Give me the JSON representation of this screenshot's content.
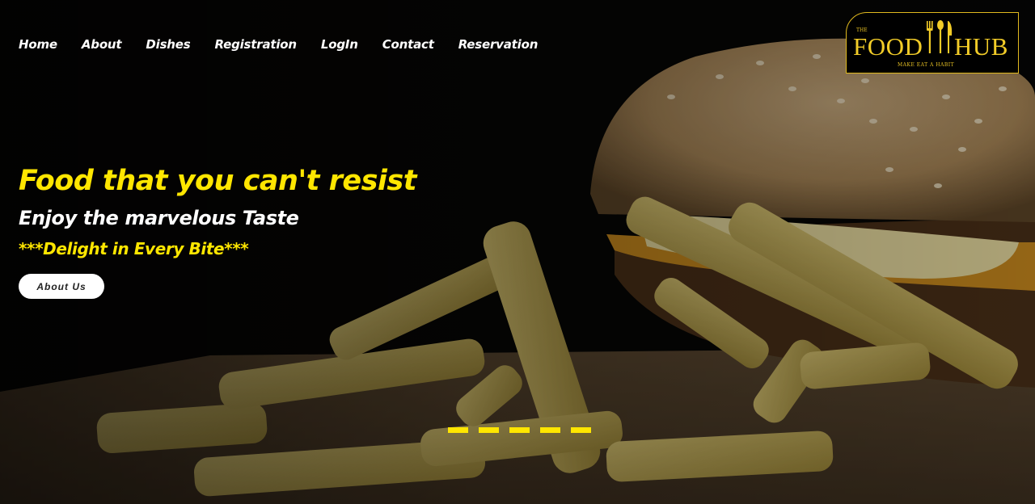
{
  "nav": {
    "items": [
      {
        "label": "Home"
      },
      {
        "label": "About"
      },
      {
        "label": "Dishes"
      },
      {
        "label": "Registration"
      },
      {
        "label": "LogIn"
      },
      {
        "label": "Contact"
      },
      {
        "label": "Reservation"
      }
    ]
  },
  "logo": {
    "prefix": "THE",
    "word1": "FOOD",
    "word2": "HUB",
    "tagline": "MAKE EAT A HABIT",
    "icon": "fork-spoon-knife-icon",
    "color": "#f2cc28"
  },
  "hero": {
    "headline": "Food that you can't resist",
    "subheadline": "Enjoy the marvelous Taste",
    "tagline": "***Delight in Every Bite***",
    "button_label": "About Us",
    "accent_color": "#ffe600",
    "background": "burger-and-fries-photo"
  },
  "carousel": {
    "slide_count": 5
  }
}
